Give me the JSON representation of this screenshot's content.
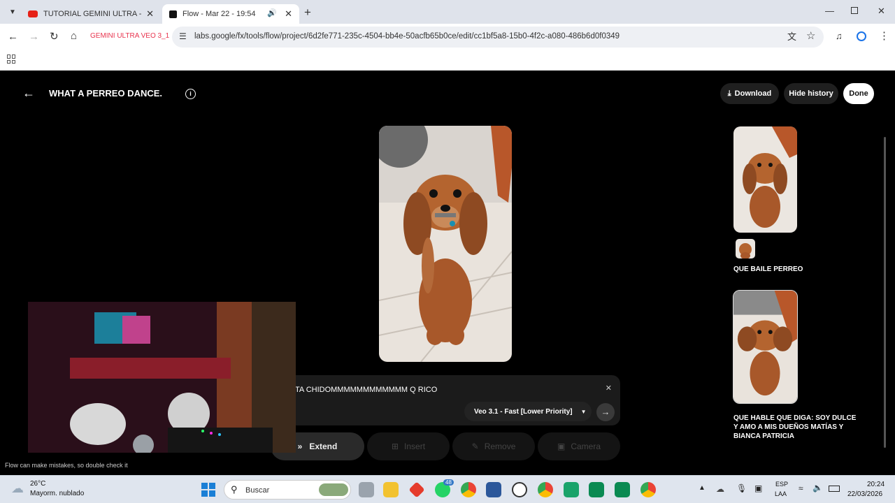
{
  "browser": {
    "tabs": [
      {
        "title": "TUTORIAL GEMINI ULTRA - VEO",
        "active": false
      },
      {
        "title": "Flow - Mar 22 - 19:54",
        "active": true
      }
    ],
    "url": "labs.google/fx/tools/flow/project/6d2fe771-235c-4504-bb4e-50acfb65b0ce/edit/cc1bf5a8-15b0-4f2c-a080-486b6d0f0349",
    "home_label": "GEMINI ULTRA VEO 3_1",
    "accent": "#e8344e"
  },
  "app": {
    "title": "WHAT A PERREO DANCE.",
    "download_label": "Download",
    "hide_history_label": "Hide history",
    "done_label": "Done"
  },
  "prompt": {
    "text": "TA CHIDOMMMMMMMMMMMM Q RICO",
    "model": "Veo 3.1 - Fast [Lower Priority]"
  },
  "actions": {
    "extend": "Extend",
    "insert": "Insert",
    "remove": "Remove",
    "camera": "Camera"
  },
  "disclaimer": "Flow can make mistakes, so double check it",
  "history": {
    "item1_caption": "QUE BAILE PERREO",
    "item2_caption": "QUE HABLE QUE DIGA: SOY DULCE Y AMO A MIS DUEÑOS MATÍAS Y BIANCA PATRICIA"
  },
  "taskbar": {
    "weather_temp": "26°C",
    "weather_desc": "Mayorm. nublado",
    "search_placeholder": "Buscar",
    "lang1": "ESP",
    "lang2": "LAA",
    "time": "20:24",
    "date": "22/03/2026",
    "whatsapp_badge": "48"
  }
}
